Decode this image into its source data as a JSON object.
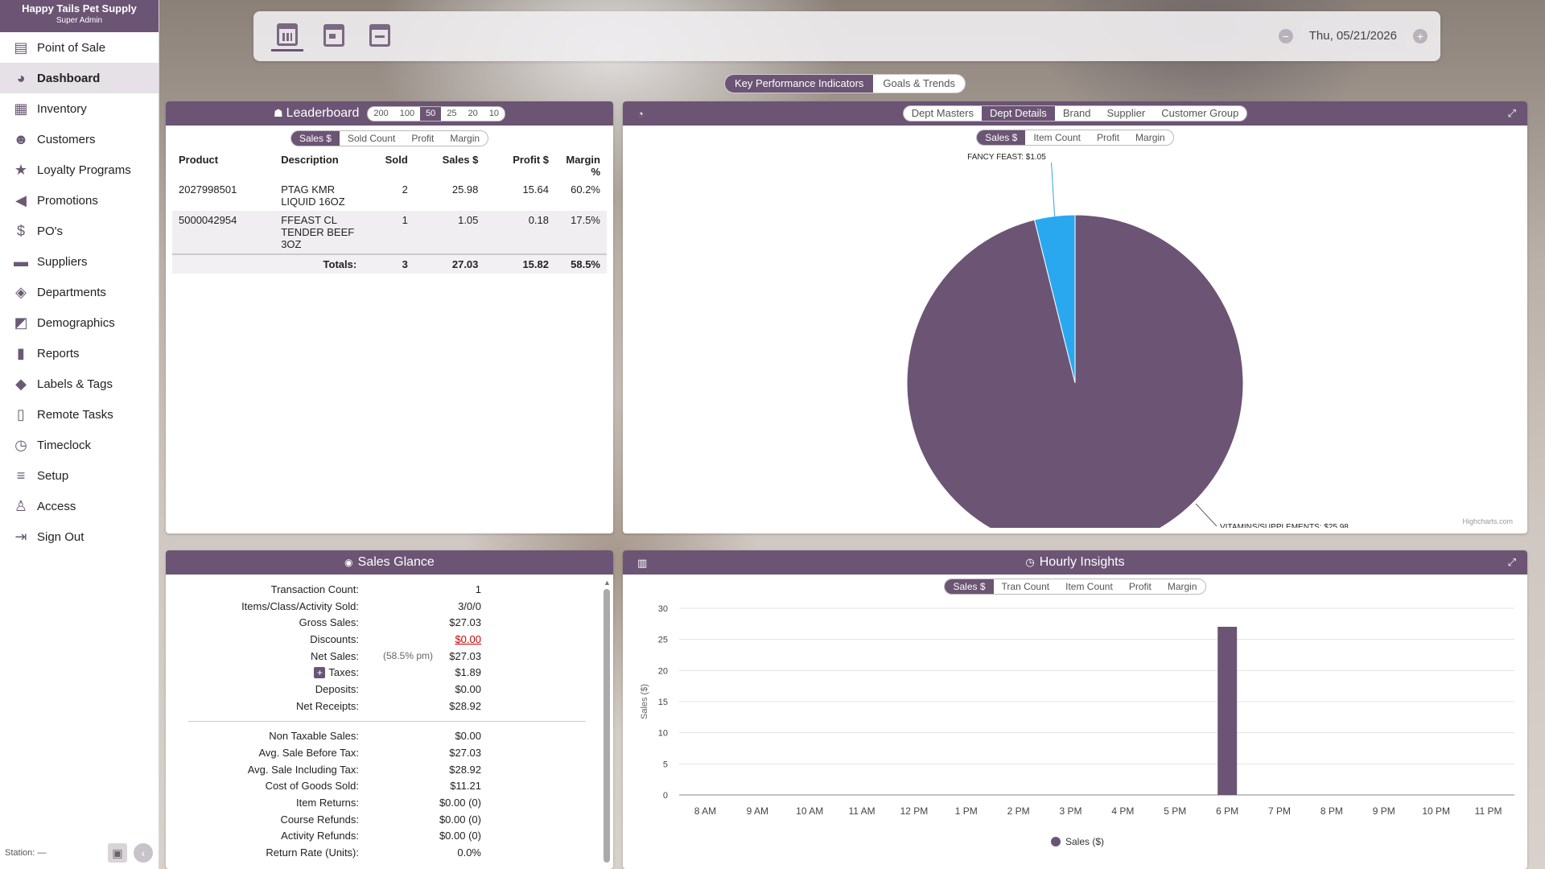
{
  "store": {
    "name": "Happy Tails Pet Supply",
    "role": "Super Admin"
  },
  "nav": [
    {
      "label": "Point of Sale",
      "icon": "register-icon"
    },
    {
      "label": "Dashboard",
      "icon": "dashboard-icon"
    },
    {
      "label": "Inventory",
      "icon": "inventory-icon"
    },
    {
      "label": "Customers",
      "icon": "customers-icon"
    },
    {
      "label": "Loyalty Programs",
      "icon": "loyalty-icon"
    },
    {
      "label": "Promotions",
      "icon": "megaphone-icon"
    },
    {
      "label": "PO's",
      "icon": "purchase-order-icon"
    },
    {
      "label": "Suppliers",
      "icon": "truck-icon"
    },
    {
      "label": "Departments",
      "icon": "layers-icon"
    },
    {
      "label": "Demographics",
      "icon": "map-pin-icon"
    },
    {
      "label": "Reports",
      "icon": "bar-chart-icon"
    },
    {
      "label": "Labels & Tags",
      "icon": "tag-icon"
    },
    {
      "label": "Remote Tasks",
      "icon": "tablet-icon"
    },
    {
      "label": "Timeclock",
      "icon": "clock-icon"
    },
    {
      "label": "Setup",
      "icon": "sliders-icon"
    },
    {
      "label": "Access",
      "icon": "user-shield-icon"
    },
    {
      "label": "Sign Out",
      "icon": "sign-out-icon"
    }
  ],
  "footer": {
    "station": "Station: —"
  },
  "date": {
    "value": "Thu, 05/21/2026"
  },
  "kpi_tabs": [
    "Key Performance Indicators",
    "Goals & Trends"
  ],
  "leaderboard": {
    "title": "Leaderboard",
    "counts": [
      "200",
      "100",
      "50",
      "25",
      "20",
      "10"
    ],
    "metrics": [
      "Sales $",
      "Sold Count",
      "Profit",
      "Margin"
    ],
    "columns": [
      "Product",
      "Description",
      "Sold",
      "Sales $",
      "Profit $",
      "Margin %"
    ],
    "rows": [
      [
        "2027998501",
        "PTAG KMR LIQUID 16OZ",
        "2",
        "25.98",
        "15.64",
        "60.2%"
      ],
      [
        "5000042954",
        "FFEAST CL TENDER BEEF 3OZ",
        "1",
        "1.05",
        "0.18",
        "17.5%"
      ]
    ],
    "totals": {
      "label": "Totals:",
      "sold": "3",
      "sales": "27.03",
      "profit": "15.82",
      "margin": "58.5%"
    }
  },
  "dept": {
    "tabs": [
      "Dept Masters",
      "Dept Details",
      "Brand",
      "Supplier",
      "Customer Group"
    ],
    "metrics": [
      "Sales $",
      "Item Count",
      "Profit",
      "Margin"
    ],
    "credit": "Highcharts.com"
  },
  "glance": {
    "title": "Sales Glance",
    "rows": [
      {
        "label": "Transaction Count:",
        "mid": "",
        "value": "1"
      },
      {
        "label": "Items/Class/Activity Sold:",
        "mid": "",
        "value": "3/0/0"
      },
      {
        "label": "Gross Sales:",
        "mid": "",
        "value": "$27.03"
      },
      {
        "label": "Discounts:",
        "mid": "",
        "value": "$0.00"
      },
      {
        "label": "Net Sales:",
        "mid": "(58.5% pm)",
        "value": "$27.03"
      },
      {
        "label": "Taxes:",
        "mid": "",
        "value": "$1.89"
      },
      {
        "label": "Deposits:",
        "mid": "",
        "value": "$0.00"
      },
      {
        "label": "Net Receipts:",
        "mid": "",
        "value": "$28.92"
      }
    ],
    "rows2": [
      {
        "label": "Non Taxable Sales:",
        "value": "$0.00"
      },
      {
        "label": "Avg. Sale Before Tax:",
        "value": "$27.03"
      },
      {
        "label": "Avg. Sale Including Tax:",
        "value": "$28.92"
      },
      {
        "label": "Cost of Goods Sold:",
        "value": "$11.21"
      },
      {
        "label": "Item Returns:",
        "value": "$0.00 (0)"
      },
      {
        "label": "Course Refunds:",
        "value": "$0.00 (0)"
      },
      {
        "label": "Activity Refunds:",
        "value": "$0.00 (0)"
      },
      {
        "label": "Return Rate (Units):",
        "value": "0.0%"
      }
    ]
  },
  "hourly": {
    "title": "Hourly Insights",
    "metrics": [
      "Sales $",
      "Tran Count",
      "Item Count",
      "Profit",
      "Margin"
    ]
  },
  "colors": {
    "accent": "#6b5474",
    "pie_secondary": "#29a8f0"
  },
  "chart_data": [
    {
      "type": "pie",
      "slices": [
        {
          "label": "VITAMINS/SUPPLEMENTS: $25.98",
          "value": 25.98
        },
        {
          "label": "FANCY FEAST: $1.05",
          "value": 1.05
        }
      ]
    },
    {
      "type": "bar",
      "categories": [
        "8 AM",
        "9 AM",
        "10 AM",
        "11 AM",
        "12 PM",
        "1 PM",
        "2 PM",
        "3 PM",
        "4 PM",
        "5 PM",
        "6 PM",
        "7 PM",
        "8 PM",
        "9 PM",
        "10 PM",
        "11 PM"
      ],
      "series": [
        {
          "name": "Sales ($)",
          "values": [
            0,
            0,
            0,
            0,
            0,
            0,
            0,
            0,
            0,
            0,
            27.03,
            0,
            0,
            0,
            0,
            0
          ]
        }
      ],
      "ylabel": "Sales ($)",
      "ylim": [
        0,
        30
      ],
      "yticks": [
        0,
        5,
        10,
        15,
        20,
        25,
        30
      ]
    }
  ]
}
